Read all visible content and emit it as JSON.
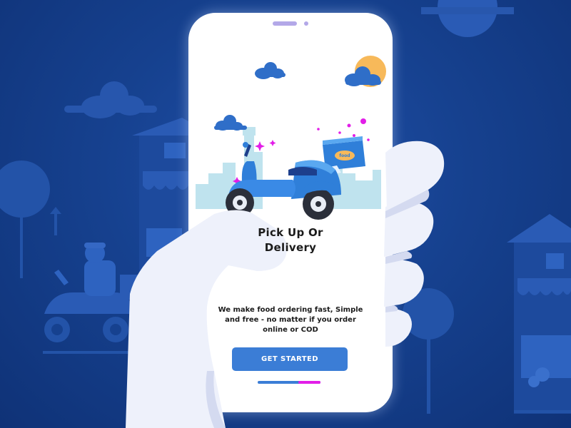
{
  "onboarding": {
    "title_line1": "Pick Up Or",
    "title_line2": "Delivery",
    "description_line1": "We make food ordering fast, Simple",
    "description_line2": "and free - no matter if you order",
    "description_line3": "online or COD",
    "cta_label": "GET STARTED"
  },
  "delivery_box": {
    "logo_text": "food"
  },
  "progress": {
    "current_step": 2,
    "total_steps": 2,
    "highlight_fraction": 0.35
  },
  "colors": {
    "background": "#16418f",
    "phone_screen": "#ffffff",
    "accent_blue": "#3b7dd6",
    "accent_pink": "#e21ee8",
    "sun": "#f7b95a",
    "hand": "#eef1fb",
    "text": "#1b1b1b"
  },
  "icons": {
    "scooter": "delivery-scooter-icon",
    "box": "delivery-box-icon",
    "cloud": "cloud-icon",
    "sun": "sun-icon",
    "sparkle": "sparkle-icon"
  }
}
